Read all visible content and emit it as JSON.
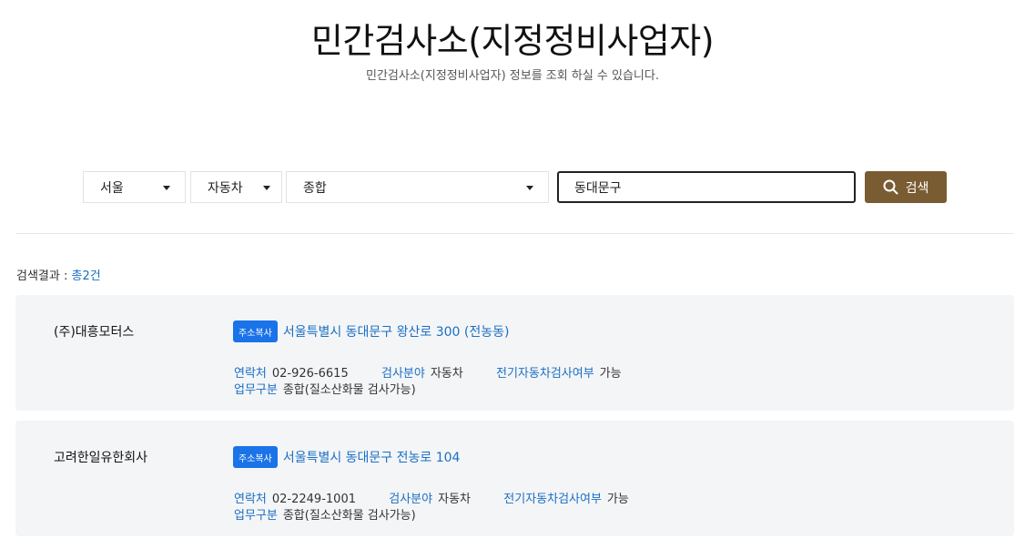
{
  "page": {
    "title": "민간검사소(지정정비사업자)",
    "subtitle": "민간검사소(지정정비사업자) 정보를 조회 하실 수 있습니다."
  },
  "search": {
    "region": "서울",
    "vehicle": "자동차",
    "inspection_type": "종합",
    "keyword": "동대문구",
    "button_label": "검색",
    "button_color": "#7a5c33"
  },
  "results": {
    "label": "검색결과 : ",
    "count_text": "총2건",
    "items": [
      {
        "name": "(주)대흥모터스",
        "badge": "주소복사",
        "address": "서울특별시 동대문구 왕산로 300 (전농동)",
        "contact_label": "연락처",
        "contact": "02-926-6615",
        "category_label": "검사분야",
        "category": "자동차",
        "ev_label": "전기자동차검사여부",
        "ev": "가능",
        "work_label": "업무구분",
        "work": "종합(질소산화물 검사가능)"
      },
      {
        "name": "고려한일유한회사",
        "badge": "주소복사",
        "address": "서울특별시 동대문구 전농로 104",
        "contact_label": "연락처",
        "contact": "02-2249-1001",
        "category_label": "검사분야",
        "category": "자동차",
        "ev_label": "전기자동차검사여부",
        "ev": "가능",
        "work_label": "업무구분",
        "work": "종합(질소산화물 검사가능)"
      }
    ]
  },
  "colors": {
    "accent_link": "#1a6fc4",
    "badge": "#1a73e8",
    "card_bg": "#f4f5f7"
  }
}
